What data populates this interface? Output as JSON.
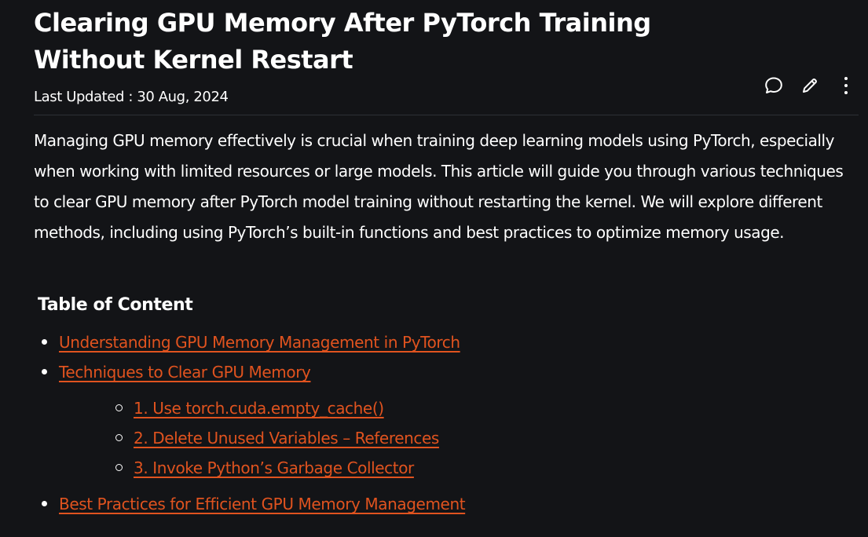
{
  "article": {
    "title": "Clearing GPU Memory After PyTorch Training Without Kernel Restart",
    "last_updated": "Last Updated : 30 Aug, 2024",
    "intro": "Managing GPU memory effectively is crucial when training deep learning models using PyTorch, especially when working with limited resources or large models. This article will guide you through various techniques to clear GPU memory after PyTorch model training without restarting the kernel. We will explore different methods, including using PyTorch’s built-in functions and best practices to optimize memory usage."
  },
  "actions": {
    "icons": [
      "comment-icon",
      "edit-icon",
      "more-options-icon"
    ]
  },
  "toc": {
    "title": "Table of Content",
    "items": [
      {
        "label": "Understanding GPU Memory Management in PyTorch"
      },
      {
        "label": "Techniques to Clear GPU Memory"
      },
      {
        "label": "Best Practices for Efficient GPU Memory Management"
      }
    ],
    "subitems": [
      {
        "label": "1. Use torch.cuda.empty_cache()"
      },
      {
        "label": "2. Delete Unused Variables – References"
      },
      {
        "label": "3. Invoke Python’s Garbage Collector"
      }
    ]
  },
  "colors": {
    "background": "#131417",
    "text": "#ffffff",
    "link": "#e0531f",
    "divider": "#2e3036"
  }
}
